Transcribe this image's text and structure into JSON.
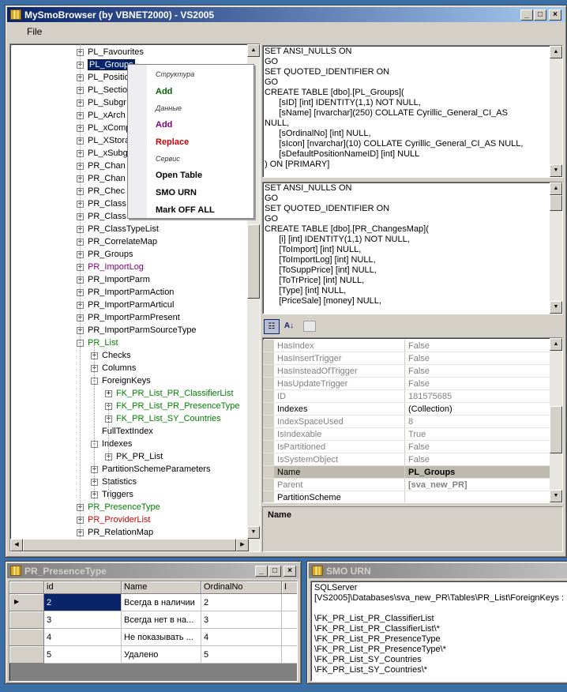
{
  "main_window": {
    "title": "MySmoBrowser (by VBNET2000) - VS2005",
    "menu": [
      "File"
    ]
  },
  "tree": {
    "items": [
      {
        "label": "PL_Favourites",
        "level": 0,
        "expander": "+",
        "color": "#000000"
      },
      {
        "label": "PL_Groups",
        "level": 0,
        "expander": "+",
        "color": "#000000",
        "selected": true
      },
      {
        "label": "PL_Positio",
        "level": 0,
        "expander": "+",
        "color": "#000000"
      },
      {
        "label": "PL_Sectio",
        "level": 0,
        "expander": "+",
        "color": "#000000"
      },
      {
        "label": "PL_Subgr",
        "level": 0,
        "expander": "+",
        "color": "#000000"
      },
      {
        "label": "PL_xArch",
        "level": 0,
        "expander": "+",
        "color": "#000000"
      },
      {
        "label": "PL_xComp",
        "level": 0,
        "expander": "+",
        "color": "#000000"
      },
      {
        "label": "PL_XStora",
        "level": 0,
        "expander": "+",
        "color": "#000000"
      },
      {
        "label": "PL_xSubg",
        "level": 0,
        "expander": "+",
        "color": "#000000"
      },
      {
        "label": "PR_Chan",
        "level": 0,
        "expander": "+",
        "color": "#000000"
      },
      {
        "label": "PR_Chan",
        "level": 0,
        "expander": "+",
        "color": "#000000"
      },
      {
        "label": "PR_Chec",
        "level": 0,
        "expander": "+",
        "color": "#000000"
      },
      {
        "label": "PR_Class",
        "level": 0,
        "expander": "+",
        "color": "#000000"
      },
      {
        "label": "PR_Class",
        "level": 0,
        "expander": "+",
        "color": "#000000"
      },
      {
        "label": "PR_ClassTypeList",
        "level": 0,
        "expander": "+",
        "color": "#000000"
      },
      {
        "label": "PR_CorrelateMap",
        "level": 0,
        "expander": "+",
        "color": "#000000"
      },
      {
        "label": "PR_Groups",
        "level": 0,
        "expander": "+",
        "color": "#000000"
      },
      {
        "label": "PR_ImportLog",
        "level": 0,
        "expander": "+",
        "color": "#800080"
      },
      {
        "label": "PR_ImportParm",
        "level": 0,
        "expander": "+",
        "color": "#000000"
      },
      {
        "label": "PR_ImportParmAction",
        "level": 0,
        "expander": "+",
        "color": "#000000"
      },
      {
        "label": "PR_ImportParmArticul",
        "level": 0,
        "expander": "+",
        "color": "#000000"
      },
      {
        "label": "PR_ImportParmPresent",
        "level": 0,
        "expander": "+",
        "color": "#000000"
      },
      {
        "label": "PR_ImportParmSourceType",
        "level": 0,
        "expander": "+",
        "color": "#000000"
      },
      {
        "label": "PR_List",
        "level": 0,
        "expander": "-",
        "color": "#008000"
      },
      {
        "label": "Checks",
        "level": 1,
        "expander": "+",
        "color": "#000000"
      },
      {
        "label": "Columns",
        "level": 1,
        "expander": "+",
        "color": "#000000"
      },
      {
        "label": "ForeignKeys",
        "level": 1,
        "expander": "-",
        "color": "#000000"
      },
      {
        "label": "FK_PR_List_PR_ClassifierList",
        "level": 2,
        "expander": "+",
        "color": "#008000"
      },
      {
        "label": "FK_PR_List_PR_PresenceType",
        "level": 2,
        "expander": "+",
        "color": "#008000"
      },
      {
        "label": "FK_PR_List_SY_Countries",
        "level": 2,
        "expander": "+",
        "color": "#008000"
      },
      {
        "label": "FullTextIndex",
        "level": 1,
        "expander": "",
        "color": "#000000"
      },
      {
        "label": "Indexes",
        "level": 1,
        "expander": "-",
        "color": "#000000"
      },
      {
        "label": "PK_PR_List",
        "level": 2,
        "expander": "+",
        "color": "#000000"
      },
      {
        "label": "PartitionSchemeParameters",
        "level": 1,
        "expander": "+",
        "color": "#000000"
      },
      {
        "label": "Statistics",
        "level": 1,
        "expander": "+",
        "color": "#000000"
      },
      {
        "label": "Triggers",
        "level": 1,
        "expander": "+",
        "color": "#000000"
      },
      {
        "label": "PR_PresenceType",
        "level": 0,
        "expander": "+",
        "color": "#008000"
      },
      {
        "label": "PR_ProviderList",
        "level": 0,
        "expander": "+",
        "color": "#cc0000"
      },
      {
        "label": "PR_RelationMap",
        "level": 0,
        "expander": "+",
        "color": "#000000"
      }
    ]
  },
  "context_menu": {
    "items": [
      {
        "label": "Структура",
        "kind": "header",
        "color": "#333333"
      },
      {
        "label": "Add",
        "kind": "item",
        "color": "#006600"
      },
      {
        "label": "Данные",
        "kind": "header",
        "color": "#333333"
      },
      {
        "label": "Add",
        "kind": "item",
        "color": "#800080"
      },
      {
        "label": "Replace",
        "kind": "item",
        "color": "#cc0000"
      },
      {
        "label": "Сервис",
        "kind": "header",
        "color": "#333333"
      },
      {
        "label": "Open Table",
        "kind": "item",
        "color": "#000000"
      },
      {
        "label": "SMO URN",
        "kind": "item",
        "color": "#000000"
      },
      {
        "label": "Mark OFF ALL",
        "kind": "item",
        "color": "#000000"
      }
    ]
  },
  "script_top": {
    "lines": [
      "SET ANSI_NULLS ON",
      "GO",
      "SET QUOTED_IDENTIFIER ON",
      "GO",
      "CREATE TABLE [dbo].[PL_Groups](",
      "\t[sID] [int] IDENTITY(1,1) NOT NULL,",
      "\t[sName] [nvarchar](250) COLLATE Cyrillic_General_CI_AS",
      "NULL,",
      "\t[sOrdinalNo] [int] NULL,",
      "\t[sIcon] [nvarchar](10) COLLATE Cyrillic_General_CI_AS NULL,",
      "\t[sDefaultPositionNameID] [int] NULL",
      ") ON [PRIMARY]"
    ]
  },
  "script_bottom": {
    "lines": [
      "SET ANSI_NULLS ON",
      "GO",
      "SET QUOTED_IDENTIFIER ON",
      "GO",
      "CREATE TABLE [dbo].[PR_ChangesMap](",
      "\t[i] [int] IDENTITY(1,1) NOT NULL,",
      "\t[ToImport] [int] NULL,",
      "\t[ToImportLog] [int] NULL,",
      "\t[ToSuppPrice] [int] NULL,",
      "\t[ToTrPrice] [int] NULL,",
      "\t[Type] [int] NULL,",
      "\t[PriceSale] [money] NULL,"
    ]
  },
  "property_grid": {
    "rows": [
      {
        "name": "HasIndex",
        "value": "False",
        "active": false
      },
      {
        "name": "HasInsertTrigger",
        "value": "False",
        "active": false
      },
      {
        "name": "HasInsteadOfTrigger",
        "value": "False",
        "active": false
      },
      {
        "name": "HasUpdateTrigger",
        "value": "False",
        "active": false
      },
      {
        "name": "ID",
        "value": "181575685",
        "active": false
      },
      {
        "name": "Indexes",
        "value": "(Collection)",
        "active": true
      },
      {
        "name": "IndexSpaceUsed",
        "value": "8",
        "active": false
      },
      {
        "name": "IsIndexable",
        "value": "True",
        "active": false
      },
      {
        "name": "IsPartitioned",
        "value": "False",
        "active": false
      },
      {
        "name": "IsSystemObject",
        "value": "False",
        "active": false
      },
      {
        "name": "Name",
        "value": "PL_Groups",
        "active": true,
        "bold": true,
        "highlight": true
      },
      {
        "name": "Parent",
        "value": "[sva_new_PR]",
        "active": false,
        "bold": true
      },
      {
        "name": "PartitionScheme",
        "value": "",
        "active": true
      }
    ],
    "description_title": "Name"
  },
  "table_window": {
    "title": "PR_PresenceType",
    "columns": [
      "id",
      "Name",
      "OrdinalNo",
      "I"
    ],
    "rows": [
      {
        "id": "2",
        "name": "Всегда в наличии",
        "ordinal": "2",
        "current": true
      },
      {
        "id": "3",
        "name": "Всегда нет в на...",
        "ordinal": "3",
        "current": false
      },
      {
        "id": "4",
        "name": "Не показывать ...",
        "ordinal": "4",
        "current": false
      },
      {
        "id": "5",
        "name": "Удалено",
        "ordinal": "5",
        "current": false
      }
    ]
  },
  "urn_window": {
    "title": "SMO URN",
    "lines": [
      "SQLServer",
      "[VS2005]\\Databases\\sva_new_PR\\Tables\\PR_List\\ForeignKeys :",
      "",
      "\\FK_PR_List_PR_ClassifierList",
      "\\FK_PR_List_PR_ClassifierList\\*",
      "\\FK_PR_List_PR_PresenceType",
      "\\FK_PR_List_PR_PresenceType\\*",
      "\\FK_PR_List_SY_Countries",
      "\\FK_PR_List_SY_Countries\\*"
    ]
  }
}
